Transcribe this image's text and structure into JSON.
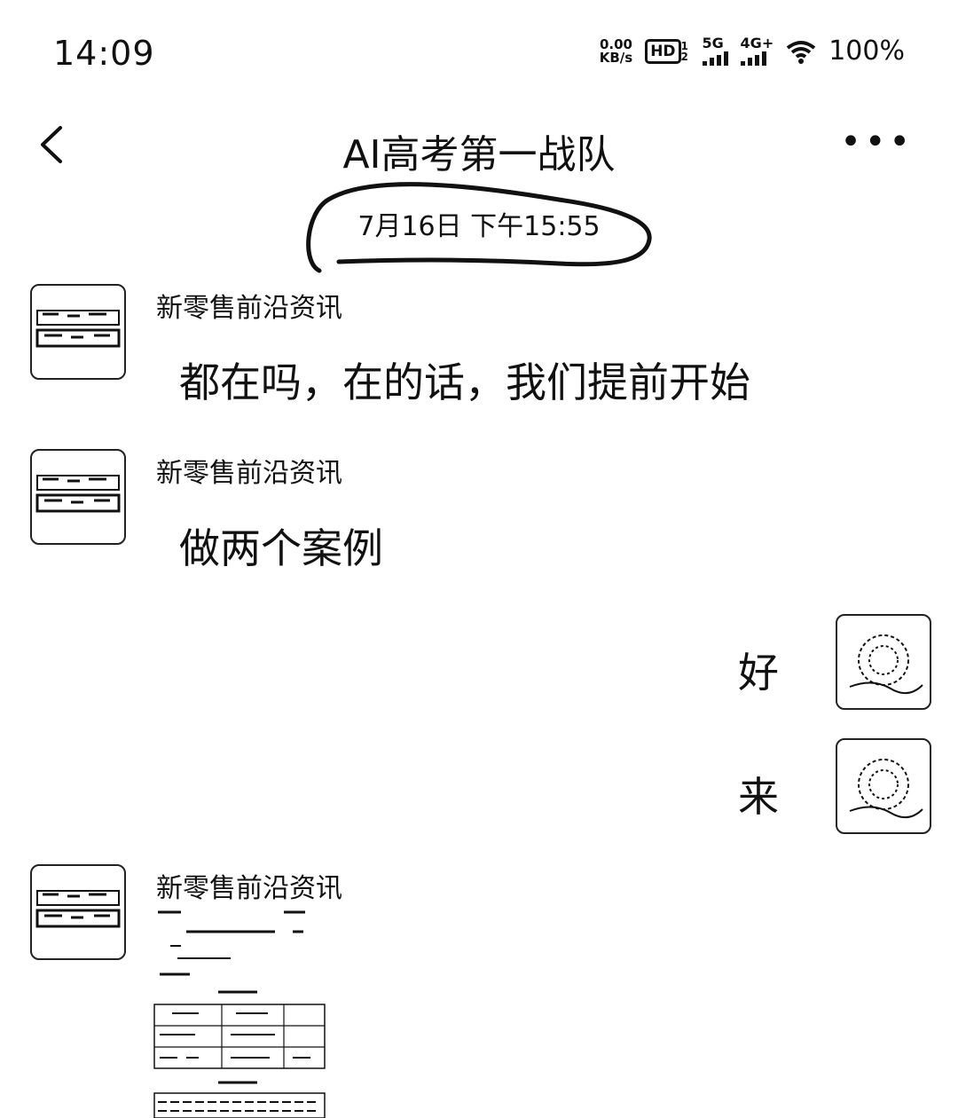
{
  "status_bar": {
    "time": "14:09",
    "net_speed_value": "0.00",
    "net_speed_unit": "KB/s",
    "hd_label": "HD",
    "hd_sub": "1 2",
    "sig1_label": "5G",
    "sig2_label": "4G+",
    "battery": "100%"
  },
  "header": {
    "title": "AI高考第一战队",
    "more": "•••"
  },
  "date_divider": "7月16日 下午15:55",
  "messages": [
    {
      "sender": "新零售前沿资讯",
      "text": "都在吗，在的话，我们提前开始",
      "side": "left"
    },
    {
      "sender": "新零售前沿资讯",
      "text": "做两个案例",
      "side": "left"
    },
    {
      "text": "好",
      "side": "right"
    },
    {
      "text": "来",
      "side": "right"
    },
    {
      "sender": "新零售前沿资讯",
      "type": "image",
      "side": "left"
    }
  ],
  "icons": {
    "back": "back-arrow-icon",
    "more": "more-dots-icon",
    "wifi": "wifi-icon"
  }
}
